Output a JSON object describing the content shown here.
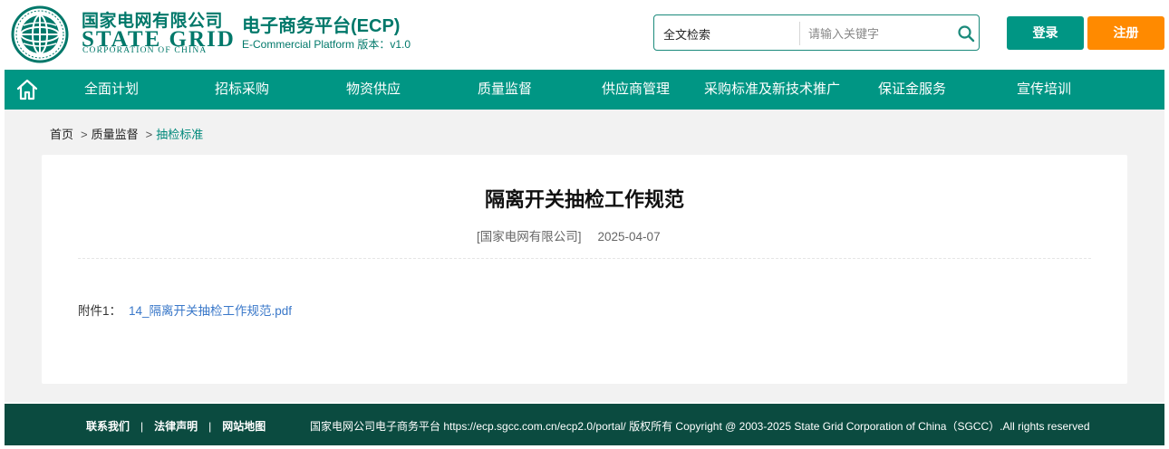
{
  "brand": {
    "name_cn": "国家电网有限公司",
    "name_en": "STATE GRID",
    "name_en_sub": "CORPORATION OF CHINA",
    "emblem_icon": "state-grid-globe-icon",
    "color_primary": "#009684",
    "color_dark": "#0b4b40",
    "color_accent": "#ff8a00"
  },
  "platform": {
    "title": "电子商务平台(ECP)",
    "subtitle": "E-Commercial Platform 版本：v1.0"
  },
  "search": {
    "type_label": "全文检索",
    "placeholder": "请输入关键字",
    "value": "",
    "icon": "search-icon"
  },
  "auth": {
    "login_label": "登录",
    "register_label": "注册"
  },
  "nav": {
    "home_icon": "home-icon",
    "items": [
      {
        "label": "全面计划"
      },
      {
        "label": "招标采购"
      },
      {
        "label": "物资供应"
      },
      {
        "label": "质量监督"
      },
      {
        "label": "供应商管理"
      },
      {
        "label": "采购标准及新技术推广"
      },
      {
        "label": "保证金服务"
      },
      {
        "label": "宣传培训"
      }
    ]
  },
  "breadcrumb": {
    "items": [
      "首页",
      "质量监督"
    ],
    "separator": ">",
    "current": "抽检标准"
  },
  "article": {
    "title": "隔离开关抽检工作规范",
    "source": "[国家电网有限公司]",
    "date": "2025-04-07",
    "attachment_label": "附件1：",
    "attachment_name": "14_隔离开关抽检工作规范.pdf"
  },
  "footer": {
    "links": [
      "联系我们",
      "法律声明",
      "网站地图"
    ],
    "separator": "|",
    "copyright": "国家电网公司电子商务平台 https://ecp.sgcc.com.cn/ecp2.0/portal/ 版权所有 Copyright @ 2003-2025 State Grid Corporation of China（SGCC）.All rights reserved"
  }
}
